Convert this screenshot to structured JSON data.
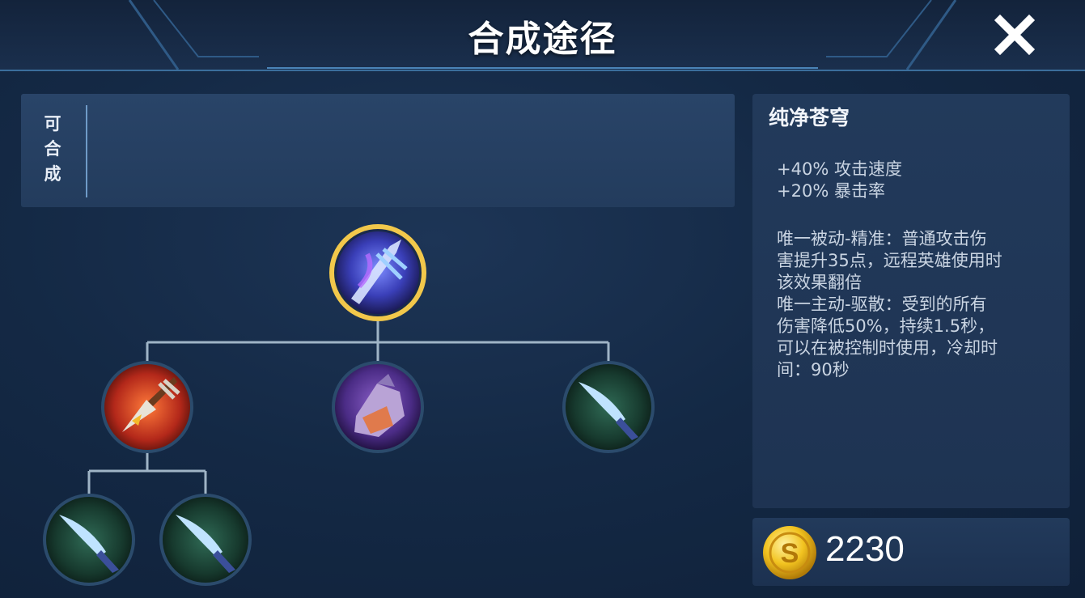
{
  "header": {
    "title": "合成途径"
  },
  "craft_panel": {
    "label": "可合成"
  },
  "tree": {
    "root": {
      "icon": "blue-purple-sword-icon"
    },
    "children": [
      {
        "icon": "red-spear-icon"
      },
      {
        "icon": "purple-glove-icon"
      },
      {
        "icon": "ice-dagger-icon"
      }
    ],
    "grandchildren": [
      {
        "icon": "ice-dagger-icon"
      },
      {
        "icon": "ice-dagger-icon"
      }
    ]
  },
  "item": {
    "name": "纯净苍穹",
    "stats": [
      "+40% 攻击速度",
      "+20% 暴击率"
    ],
    "description_lines": [
      "唯一被动-精准：普通攻击伤",
      "害提升35点，远程英雄使用时",
      "该效果翻倍",
      "唯一主动-驱散：受到的所有",
      "伤害降低50%，持续1.5秒，",
      "可以在被控制时使用，冷却时",
      "间：90秒"
    ]
  },
  "price": {
    "value": "2230",
    "icon": "gold-coin-icon"
  },
  "colors": {
    "background": "#142945",
    "panel": "#233c5d",
    "line": "#9fb4c6",
    "gold_ring": "#f2c84b"
  }
}
